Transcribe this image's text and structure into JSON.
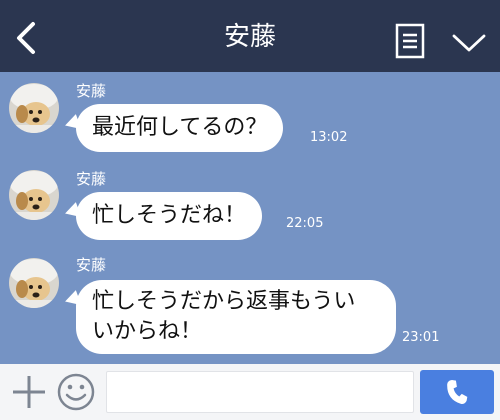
{
  "header": {
    "title": "安藤",
    "back_icon": "chevron-left-icon",
    "menu_icon": "list-icon",
    "collapse_icon": "chevron-down-icon"
  },
  "messages": [
    {
      "sender": "安藤",
      "text": "最近何してるの？",
      "time": "13:02"
    },
    {
      "sender": "安藤",
      "text": "忙しそうだね！",
      "time": "22:05"
    },
    {
      "sender": "安藤",
      "line1": "忙しそうだから返事もうい",
      "line2": "いからね！",
      "time": "23:01"
    }
  ],
  "footer": {
    "input_value": "",
    "plus_icon": "plus-icon",
    "emoji_icon": "smiley-icon",
    "call_icon": "phone-icon"
  },
  "colors": {
    "header_bg": "#2b3650",
    "chat_bg": "#7593c4",
    "bubble_bg": "#ffffff",
    "call_button": "#4a7fe0",
    "footer_bg": "#f4f5f7"
  }
}
